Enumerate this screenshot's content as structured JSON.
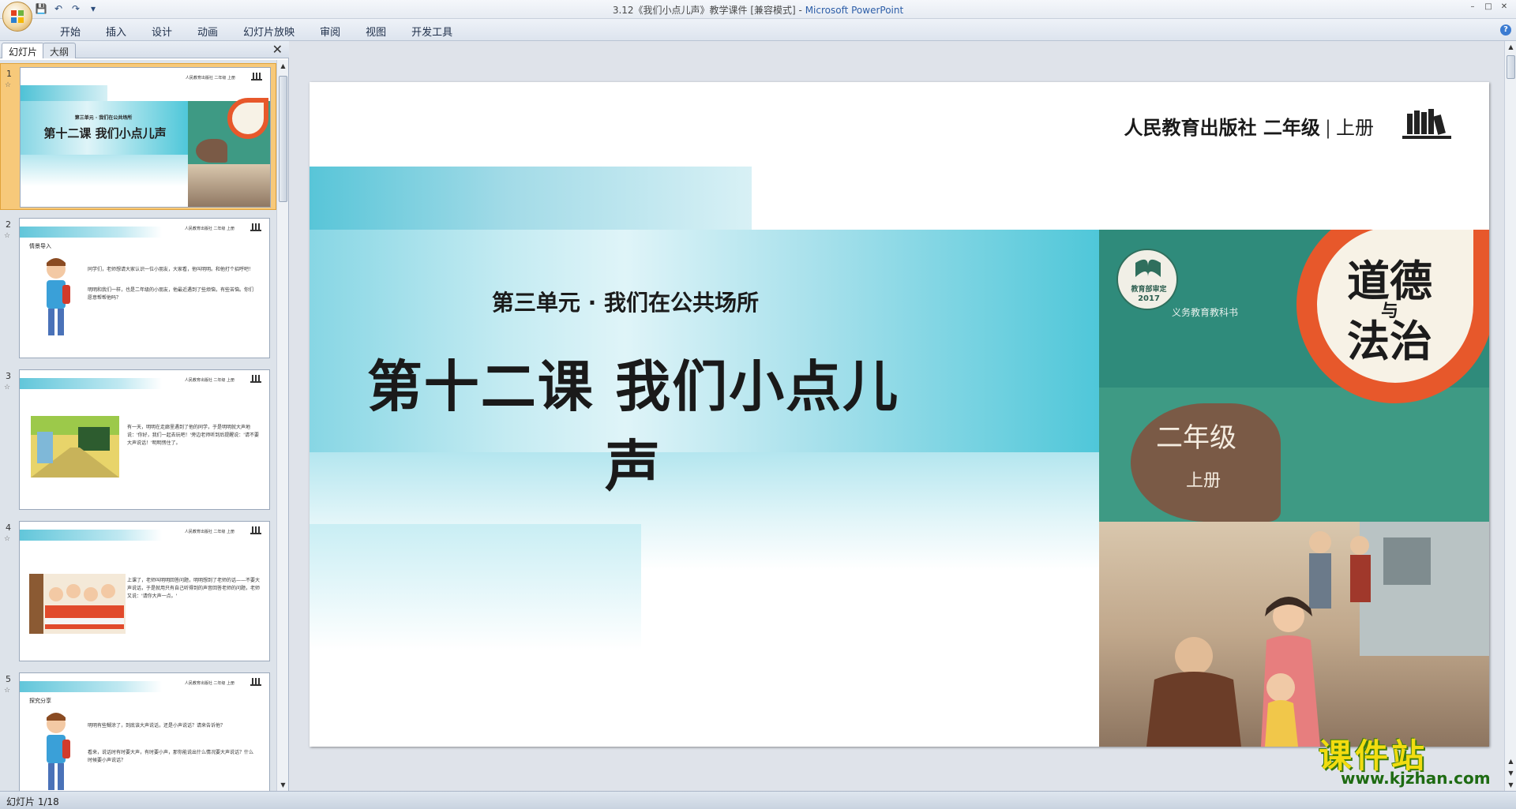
{
  "window": {
    "title": "3.12《我们小点儿声》教学课件 [兼容模式]",
    "title_sep": " - ",
    "app_name": "Microsoft PowerPoint"
  },
  "ribbon": {
    "tabs": [
      "开始",
      "插入",
      "设计",
      "动画",
      "幻灯片放映",
      "审阅",
      "视图",
      "开发工具"
    ]
  },
  "left_panel": {
    "tab_slides": "幻灯片",
    "tab_outline": "大纲",
    "thumbnails": [
      {
        "num": "1",
        "selected": true
      },
      {
        "num": "2",
        "section": "情景导入",
        "paragraphs": [
          "同学们，老师想请大家认识一位小朋友，大家看，他叫明明。和他打个招呼吧！",
          "明明和我们一样，也是二年级的小朋友，他最近遇到了些烦恼，有些苦恼。你们愿意帮帮他吗？"
        ]
      },
      {
        "num": "3",
        "paragraphs": [
          "有一天，明明在走廊里遇到了他的同学，于是明明就大声地说：'你好，我们一起去玩吧！'旁边老师听到后提醒说：'请不要大声说话！'明明愣住了。"
        ]
      },
      {
        "num": "4",
        "paragraphs": [
          "上课了，老师叫明明回答问题，明明想到了老师的话——不要大声说话，于是就用只有自己听得到的声音回答老师的问题，老师又说：'请你大声一点。'"
        ]
      },
      {
        "num": "5",
        "section": "探究分享",
        "paragraphs": [
          "明明有些糊涂了，到底该大声说话，还是小声说话？请来告诉他？",
          "看来，说话时有时要大声，有时要小声，那你能说出什么情况要大声说话？什么时候要小声说话？"
        ]
      }
    ],
    "thumb_header": "人民教育出版社 二年级 上册"
  },
  "slide": {
    "publisher": "人民教育出版社 二年级",
    "separator": "|",
    "volume": "上册",
    "unit_title": "第三单元 · 我们在公共场所",
    "lesson_title": "第十二课  我们小点儿声",
    "cover": {
      "title_line1": "道德",
      "title_small": "与",
      "title_line2": "法治",
      "seal_text": "教育部审定",
      "seal_year": "2017",
      "series": "义务教育教科书",
      "grade": "二年级",
      "volume": "上册"
    },
    "thumb1_unit": "第三单元 · 我们在公共场所",
    "thumb1_lesson": "第十二课  我们小点儿声"
  },
  "watermark": {
    "main": "课件站",
    "url": "www.kjzhan.com"
  },
  "statusbar": {
    "slide_indicator": "幻灯片 1/18"
  },
  "colors": {
    "accent_teal": "#4fc7d9",
    "cover_green": "#3e9a84",
    "cover_orange": "#e7582b",
    "selected_thumb": "#f7c97a"
  }
}
